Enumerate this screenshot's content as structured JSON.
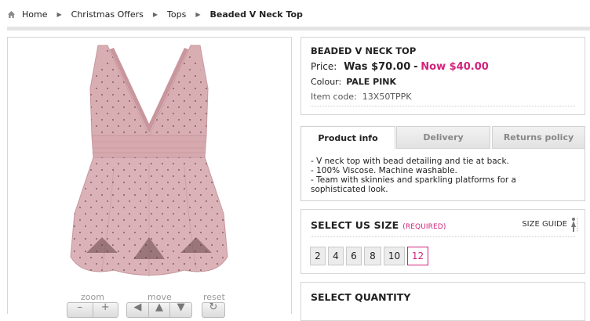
{
  "breadcrumb": {
    "items": [
      "Home",
      "Christmas Offers",
      "Tops"
    ],
    "current": "Beaded V Neck Top"
  },
  "product": {
    "title": "BEADED V NECK TOP",
    "price_label": "Price:",
    "was_price": "Was $70.00",
    "price_separator": "-",
    "now_price": "Now $40.00",
    "colour_label": "Colour:",
    "colour_value": "PALE PINK",
    "item_code_label": "Item code:",
    "item_code_value": "13X50TPPK"
  },
  "image_controls": {
    "zoom_label": "zoom",
    "move_label": "move",
    "reset_label": "reset"
  },
  "tabs": [
    {
      "label": "Product info",
      "active": true
    },
    {
      "label": "Delivery",
      "active": false
    },
    {
      "label": "Returns policy",
      "active": false
    }
  ],
  "product_info": [
    "- V neck top with bead detailing and tie at back.",
    "- 100% Viscose. Machine washable.",
    "- Team with skinnies and sparkling platforms for a",
    "sophisticated look."
  ],
  "size_section": {
    "title": "SELECT US SIZE",
    "required": "(REQUIRED)",
    "size_guide": "SIZE GUIDE",
    "sizes": [
      "2",
      "4",
      "6",
      "8",
      "10",
      "12"
    ],
    "selected": "12"
  },
  "quantity_section": {
    "title": "SELECT QUANTITY"
  },
  "colors": {
    "accent": "#d4237b",
    "border": "#d6d6d6",
    "product": "#d9aeb3"
  }
}
